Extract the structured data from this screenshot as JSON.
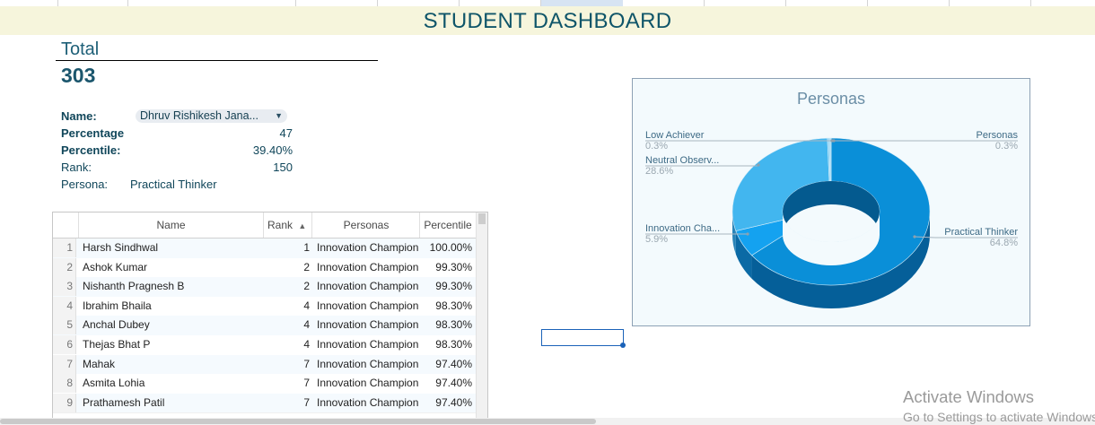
{
  "header": {
    "title": "STUDENT DASHBOARD"
  },
  "summary": {
    "total_label": "Total",
    "total_value": "303"
  },
  "student": {
    "name_label": "Name:",
    "name_value": "Dhruv Rishikesh Jana...",
    "percentage_label": "Percentage",
    "percentage_value": "47",
    "percentile_label": "Percentile:",
    "percentile_value": "39.40%",
    "rank_label": "Rank:",
    "rank_value": "150",
    "persona_label": "Persona:",
    "persona_value": "Practical Thinker"
  },
  "table": {
    "columns": [
      "Name",
      "Rank",
      "Personas",
      "Percentile"
    ],
    "sort_indicator": "▲",
    "rows": [
      {
        "idx": "1",
        "name": "Harsh Sindhwal",
        "rank": "1",
        "persona": "Innovation Champion",
        "pct": "100.00%"
      },
      {
        "idx": "2",
        "name": "Ashok Kumar",
        "rank": "2",
        "persona": "Innovation Champion",
        "pct": "99.30%"
      },
      {
        "idx": "3",
        "name": "Nishanth Pragnesh B",
        "rank": "2",
        "persona": "Innovation Champion",
        "pct": "99.30%"
      },
      {
        "idx": "4",
        "name": "Ibrahim Bhaila",
        "rank": "4",
        "persona": "Innovation Champion",
        "pct": "98.30%"
      },
      {
        "idx": "5",
        "name": "Anchal Dubey",
        "rank": "4",
        "persona": "Innovation Champion",
        "pct": "98.30%"
      },
      {
        "idx": "6",
        "name": "Thejas Bhat P",
        "rank": "4",
        "persona": "Innovation Champion",
        "pct": "98.30%"
      },
      {
        "idx": "7",
        "name": "Mahak",
        "rank": "7",
        "persona": "Innovation Champion",
        "pct": "97.40%"
      },
      {
        "idx": "8",
        "name": "Asmita Lohia",
        "rank": "7",
        "persona": "Innovation Champion",
        "pct": "97.40%"
      },
      {
        "idx": "9",
        "name": "Prathamesh Patil",
        "rank": "7",
        "persona": "Innovation Champion",
        "pct": "97.40%"
      }
    ]
  },
  "persona_chart": {
    "title": "Personas",
    "slices": [
      {
        "label": "Practical Thinker",
        "value_text": "64.8%",
        "value": 64.8,
        "color": "#0a8fd8",
        "side_color": "#055f99"
      },
      {
        "label": "Innovation Cha...",
        "value_text": "5.9%",
        "value": 5.9,
        "color": "#14a2f0",
        "side_color": "#0b6aa5"
      },
      {
        "label": "Neutral Observ...",
        "value_text": "28.6%",
        "value": 28.6,
        "color": "#42b6ef",
        "side_color": "#2a84b8"
      },
      {
        "label": "Low Achiever",
        "value_text": "0.3%",
        "value": 0.3,
        "color": "#7fcdf3",
        "side_color": "#4b9cc6"
      },
      {
        "label": "Personas",
        "value_text": "0.3%",
        "value": 0.3,
        "color": "#9bd7f5",
        "side_color": "#5aa8cc"
      }
    ]
  },
  "watermark": {
    "line1": "Activate Windows",
    "line2": "Go to Settings to activate Windows."
  }
}
